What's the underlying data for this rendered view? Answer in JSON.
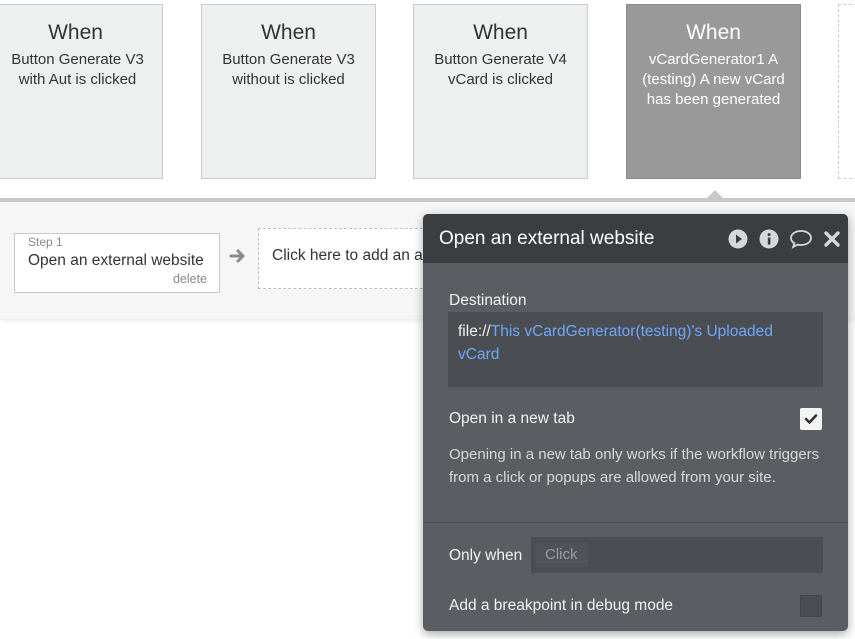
{
  "events": [
    {
      "title": "When",
      "desc": "Button Generate V3 with Aut is clicked"
    },
    {
      "title": "When",
      "desc": "Button Generate V3 without is clicked"
    },
    {
      "title": "When",
      "desc": "Button Generate V4 vCard is clicked"
    },
    {
      "title": "When",
      "desc": "vCardGenerator1 A (testing) A new vCard has been generated"
    }
  ],
  "step": {
    "number": "Step 1",
    "label": "Open an external website",
    "delete": "delete"
  },
  "add_action": "Click here to add an action...",
  "panel": {
    "title": "Open an external website",
    "icons": [
      "play-icon",
      "info-icon",
      "comment-icon",
      "close-icon"
    ],
    "destination_label": "Destination",
    "destination_prefix": "file://",
    "destination_dynamic": "This vCardGenerator(testing)'s Uploaded vCard",
    "new_tab_label": "Open in a new tab",
    "new_tab_checked": true,
    "new_tab_note": "Opening in a new tab only works if the workflow triggers from a click or popups are allowed from your site.",
    "only_when_label": "Only when",
    "only_when_placeholder": "Click",
    "breakpoint_label": "Add a breakpoint in debug mode"
  },
  "colors": {
    "dynamic_text": "#6fa8ff",
    "panel_bg": "#5a5e62",
    "panel_header": "#3b3e41",
    "selected_event": "#999999"
  }
}
